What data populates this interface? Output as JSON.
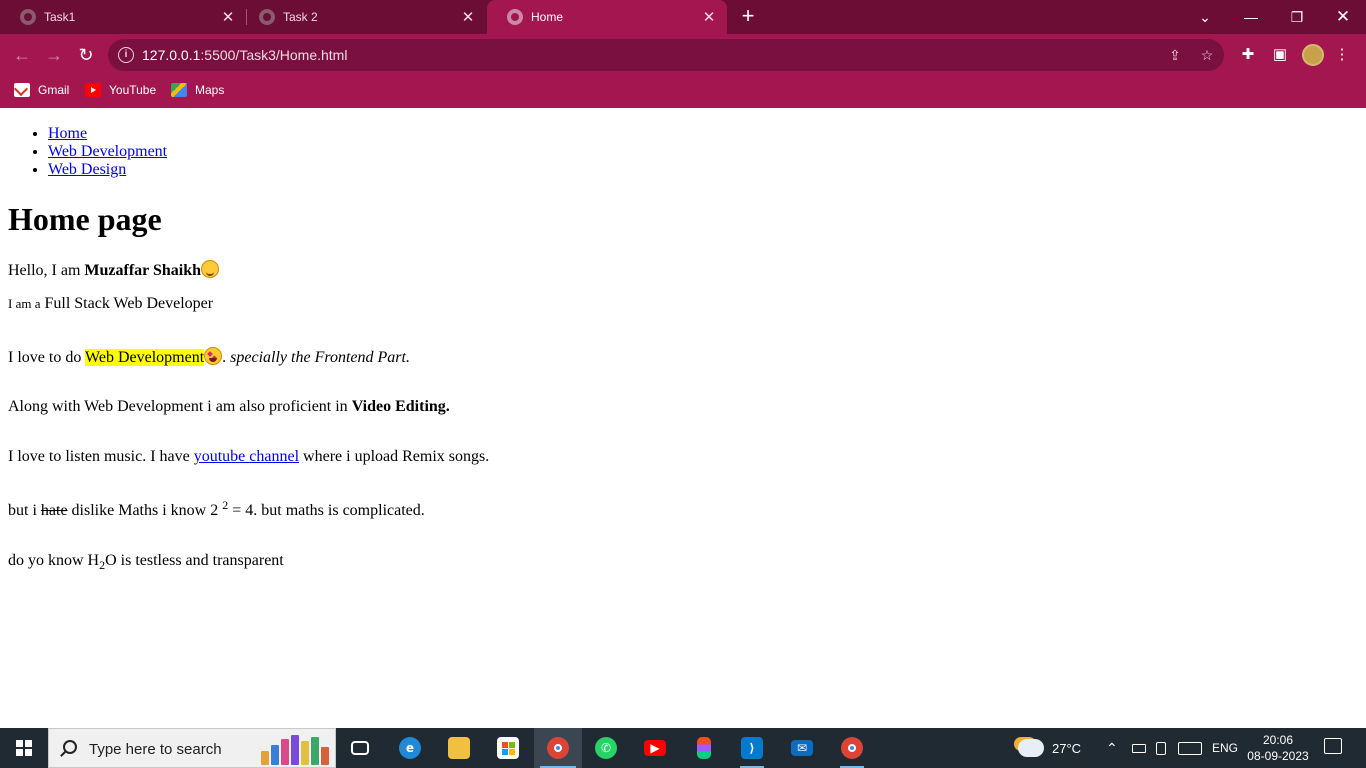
{
  "browser": {
    "tabs": [
      {
        "title": "Task1",
        "active": false
      },
      {
        "title": "Task 2",
        "active": false
      },
      {
        "title": "Home",
        "active": true
      }
    ],
    "url_host": "127.0.0.1",
    "url_path": ":5500/Task3/Home.html",
    "bookmarks": [
      {
        "label": "Gmail",
        "icon": "gmail-icon"
      },
      {
        "label": "YouTube",
        "icon": "youtube-icon"
      },
      {
        "label": "Maps",
        "icon": "maps-icon"
      }
    ],
    "accent_color": "#a3164f",
    "tabstrip_color": "#6b0d35"
  },
  "page": {
    "nav": [
      "Home",
      "Web Development",
      "Web Design"
    ],
    "heading": "Home page",
    "intro": {
      "prefix": "Hello, I am ",
      "name": "Muzaffar Shaikh"
    },
    "role": {
      "small": "I am a",
      "rest": " Full Stack Web Developer"
    },
    "love": {
      "prefix": "I love to do ",
      "highlight": "Web Development",
      "suffix": ". ",
      "italic": "specially the Frontend Part."
    },
    "video": {
      "prefix": "Along with Web Development i am also proficient in ",
      "bold": "Video Editing."
    },
    "music": {
      "prefix": "I love to listen music. I have ",
      "link": "youtube channel",
      "suffix": " where i upload Remix songs."
    },
    "maths": {
      "prefix": "but i ",
      "struck": "hate",
      "middle": " dislike Maths i know 2 ",
      "sup": "2",
      "suffix": " = 4. but maths is complicated."
    },
    "water": {
      "prefix": "do yo know H",
      "sub": "2",
      "suffix": "O is testless and transparent"
    },
    "highlight_color": "#ffff00",
    "link_color": "#0000ee"
  },
  "taskbar": {
    "search_placeholder": "Type here to search",
    "weather": "27°C",
    "language": "ENG",
    "time": "20:06",
    "date": "08-09-2023"
  }
}
